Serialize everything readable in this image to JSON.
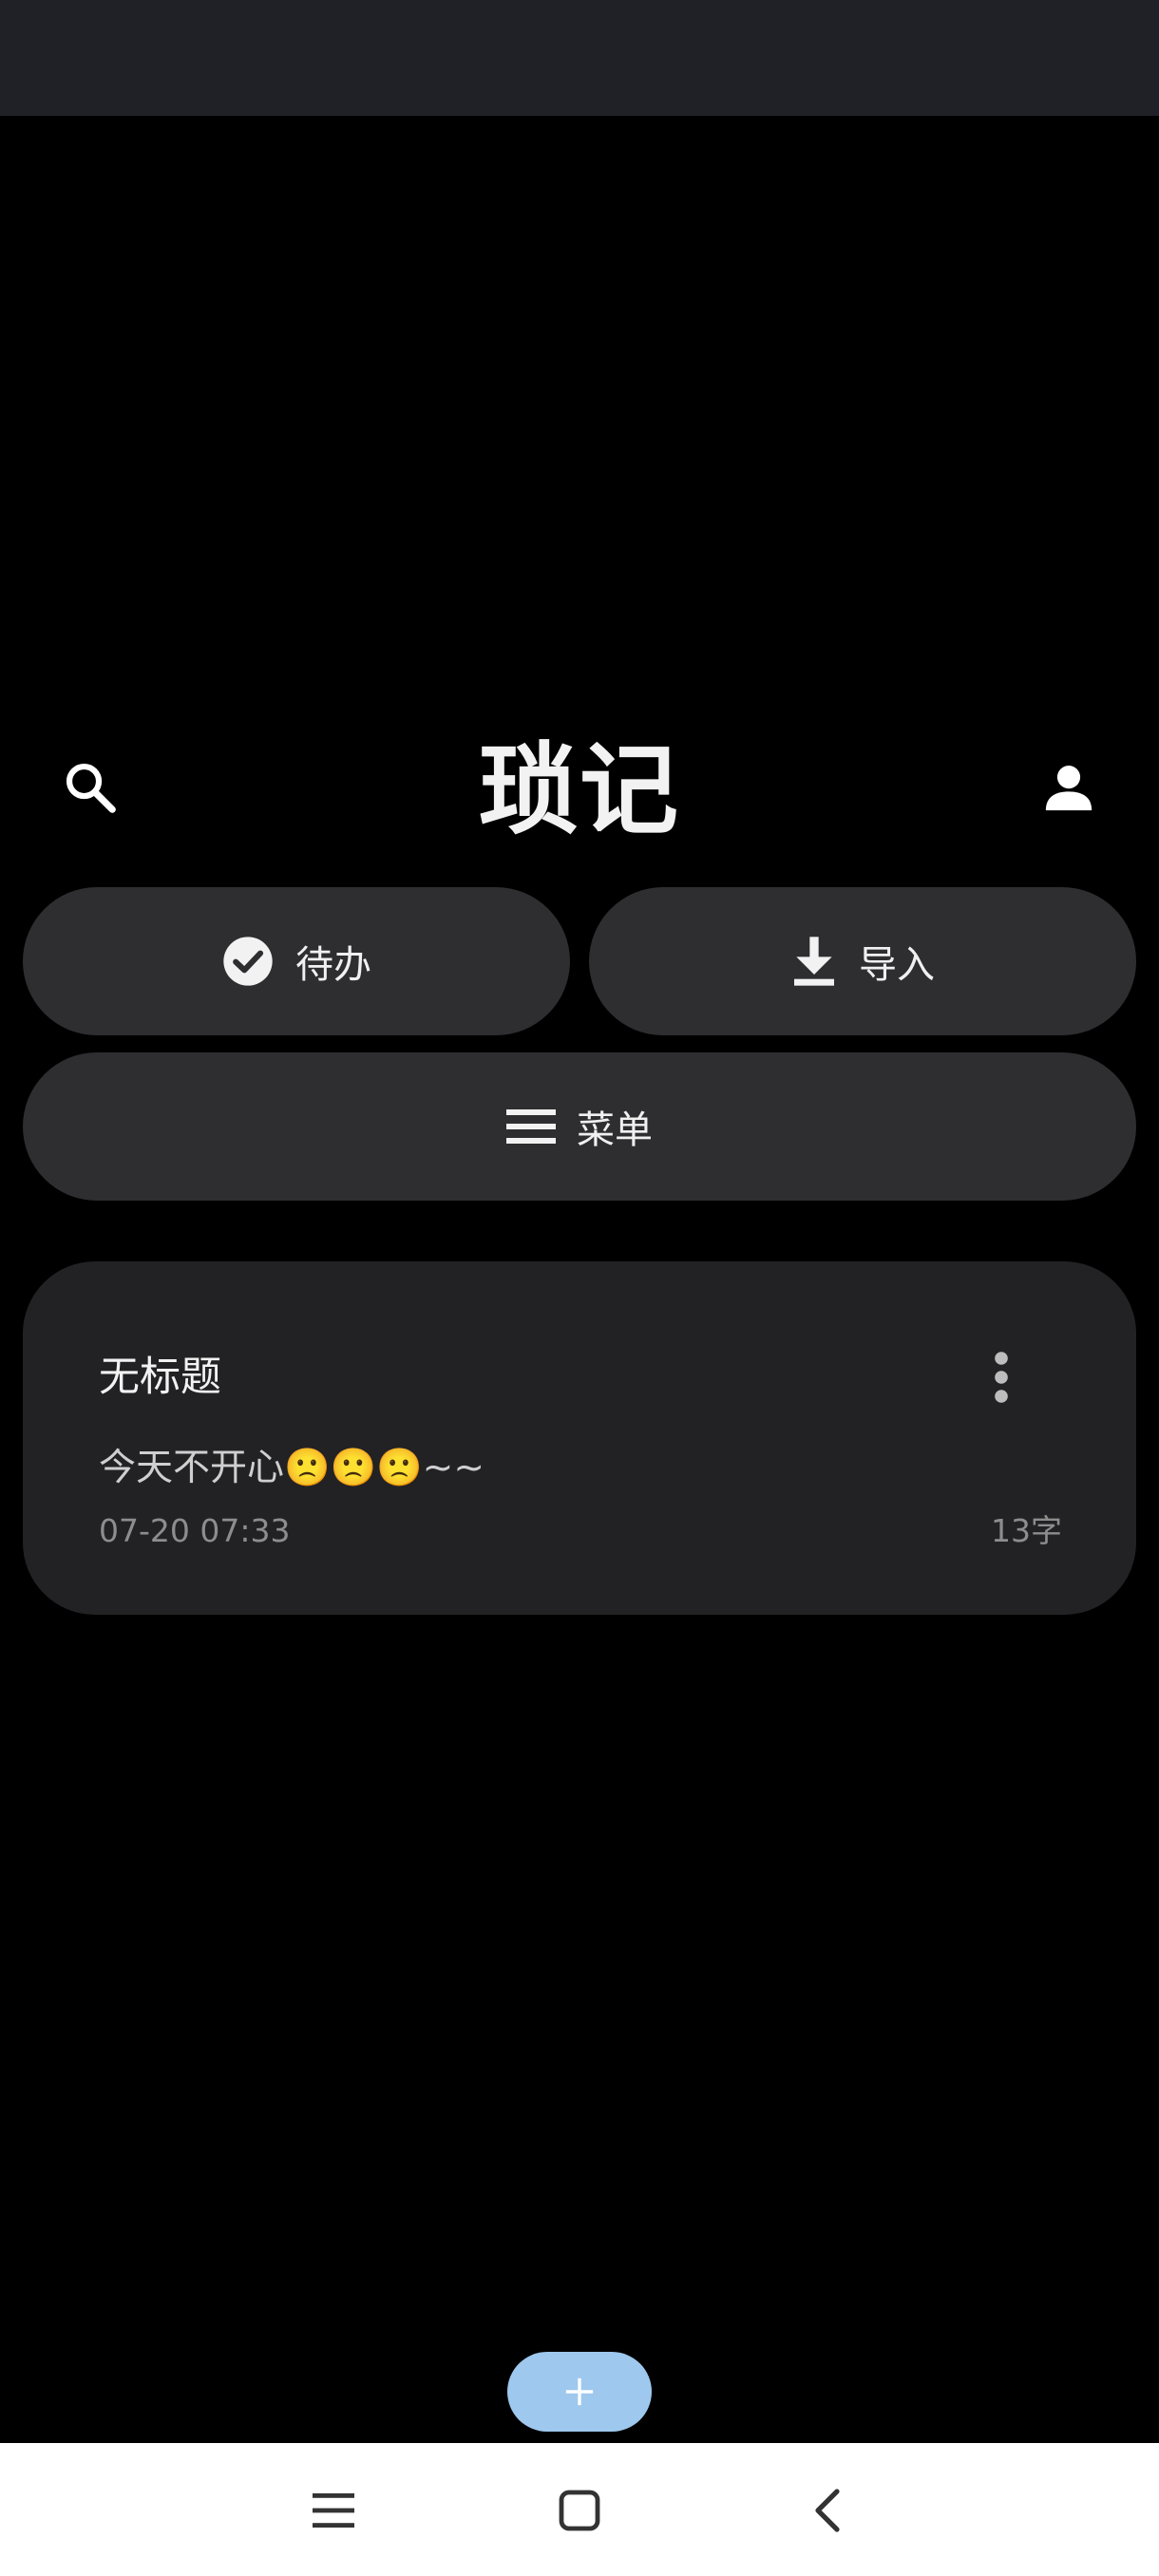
{
  "app": {
    "title": "琐记"
  },
  "header": {
    "search_icon": "search-icon",
    "profile_icon": "person-icon"
  },
  "actions": {
    "todo": {
      "label": "待办",
      "icon": "check-circle-icon"
    },
    "import": {
      "label": "导入",
      "icon": "download-icon"
    },
    "menu": {
      "label": "菜单",
      "icon": "hamburger-icon"
    }
  },
  "notes": [
    {
      "title": "无标题",
      "body": "今天不开心🙁🙁🙁~~",
      "date": "07-20 07:33",
      "count": "13字"
    }
  ],
  "fab": {
    "icon": "plus-icon",
    "color": "#9ec8ee"
  },
  "system_nav": {
    "recents_icon": "recents-menu-icon",
    "home_icon": "home-square-icon",
    "back_icon": "back-chevron-icon"
  },
  "colors": {
    "background": "#000000",
    "status_bar": "#202126",
    "button": "#2e2e31",
    "card": "#222224",
    "fab": "#9ec8ee"
  }
}
